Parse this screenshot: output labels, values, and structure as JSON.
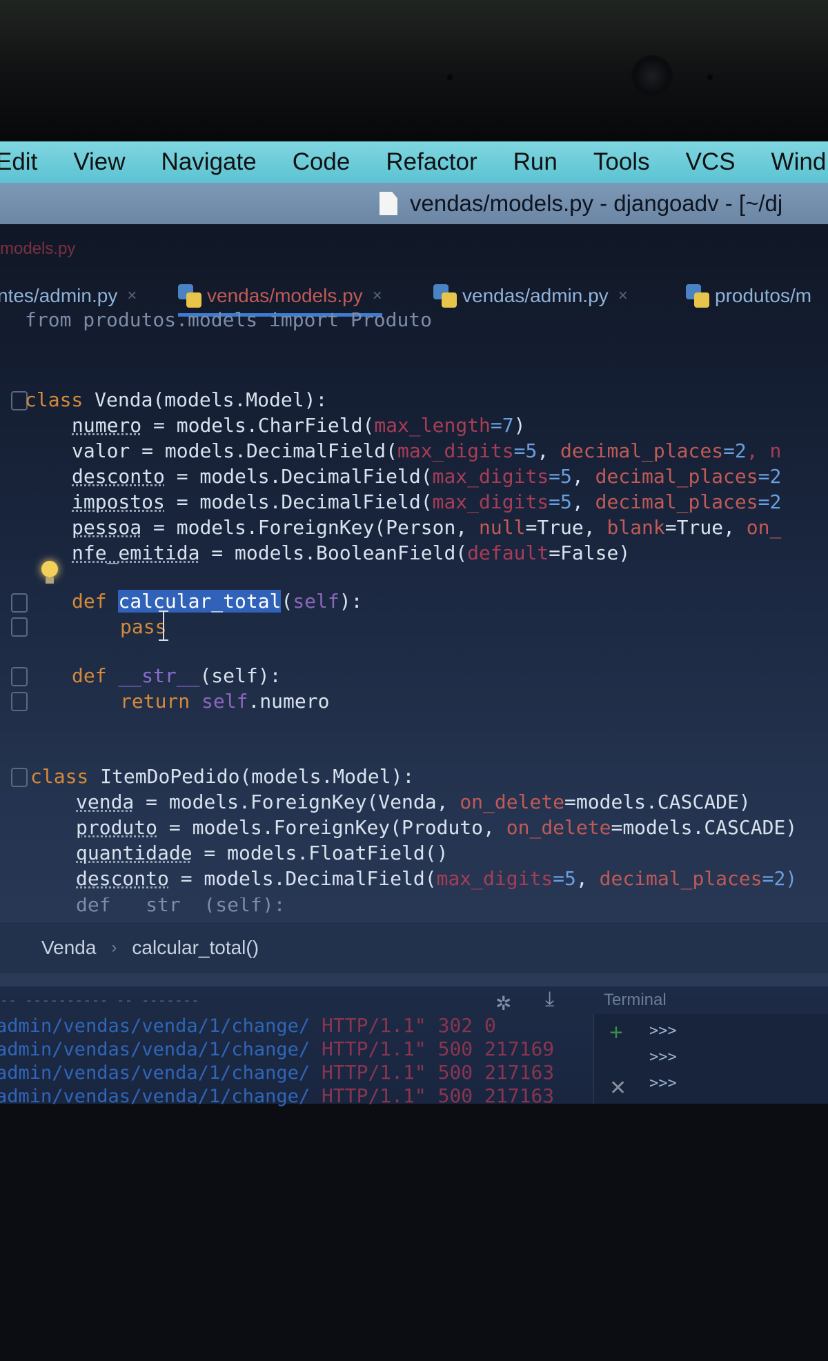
{
  "menu": [
    "Edit",
    "View",
    "Navigate",
    "Code",
    "Refactor",
    "Run",
    "Tools",
    "VCS",
    "Wind"
  ],
  "window_title": "vendas/models.py - djangoadv - [~/dj",
  "nav_crumb": "models.py",
  "tabs": [
    {
      "label": "ntes/admin.py",
      "active": false
    },
    {
      "label": "vendas/models.py",
      "active": true
    },
    {
      "label": "vendas/admin.py",
      "active": false
    },
    {
      "label": "produtos/m",
      "active": false
    }
  ],
  "code": {
    "l0": "from produtos.models import Produto",
    "l1": {
      "kw": "class",
      "name": "Venda(models.Model):"
    },
    "l2": {
      "a": "numero",
      "b": " = models.CharField(",
      "p1": "max_length",
      "v1": "=7",
      "e": ")"
    },
    "l3": {
      "a": "valor",
      "b": " = models.DecimalField(",
      "p1": "max_digits",
      "v1": "=5",
      "c1": ", ",
      "p2": "decimal_places",
      "v2": "=2",
      "c2": ", n"
    },
    "l4": {
      "a": "desconto",
      "b": " = models.DecimalField(",
      "p1": "max_digits",
      "v1": "=5",
      "c1": ", ",
      "p2": "decimal_places",
      "v2": "=2"
    },
    "l5": {
      "a": "impostos",
      "b": " = models.DecimalField(",
      "p1": "max_digits",
      "v1": "=5",
      "c1": ", ",
      "p2": "decimal_places",
      "v2": "=2"
    },
    "l6": {
      "a": "pessoa",
      "b": " = models.ForeignKey(Person, ",
      "p1": "null",
      "v1": "=True",
      "c1": ", ",
      "p2": "blank",
      "v2": "=True",
      "c2": ", ",
      "p3": "on_"
    },
    "l7": {
      "a": "nfe_emitida",
      "b": " = models.BooleanField(",
      "p1": "default",
      "v1": "=False",
      "e": ")"
    },
    "l8": {
      "kw": "def",
      "fn": "calcular_total",
      "op": "(",
      "self": "self",
      "cl": "):"
    },
    "l9": {
      "kw": "pass"
    },
    "l10": {
      "kw": "def",
      "dn": "__str__",
      "rest": "(self):"
    },
    "l11": {
      "kw": "return",
      "self": "self",
      "rest": ".numero"
    },
    "l12": {
      "kw": "class",
      "name": "ItemDoPedido(models.Model):"
    },
    "l13": {
      "a": "venda",
      "b": " = models.ForeignKey(Venda, ",
      "p1": "on_delete",
      "v1": "=models.CASCADE)"
    },
    "l14": {
      "a": "produto",
      "b": " = models.ForeignKey(Produto, ",
      "p1": "on_delete",
      "v1": "=models.CASCADE)"
    },
    "l15": {
      "a": "quantidade",
      "b": " = models.FloatField()"
    },
    "l16": {
      "a": "desconto",
      "b": " = models.DecimalField(",
      "p1": "max_digits",
      "v1": "=5",
      "c1": ", ",
      "p2": "decimal_places",
      "v2": "=2)"
    },
    "l17": "def __str__(self):"
  },
  "breadcrumb": {
    "class_name": "Venda",
    "method": "calcular_total()"
  },
  "bottom": {
    "top_clip": "-- ---------- -- -------",
    "terminal_label": "Terminal",
    "prompts": [
      ">>>",
      ">>>",
      ">>>"
    ],
    "logs": [
      {
        "path": "admin/vendas/venda/1/change/",
        "proto": " HTTP/1.1\"",
        "status": " 302 0"
      },
      {
        "path": "admin/vendas/venda/1/change/",
        "proto": " HTTP/1.1\"",
        "status": " 500 217169"
      },
      {
        "path": "admin/vendas/venda/1/change/",
        "proto": " HTTP/1.1\"",
        "status": " 500 217163"
      },
      {
        "path": "admin/vendas/venda/1/change/",
        "proto": " HTTP/1.1\"",
        "status": " 500 217163"
      }
    ]
  },
  "colors": {
    "menu_bg": "#5cc3d2",
    "title_bg": "#6c86a4",
    "editor_bg": "#19253d",
    "keyword": "#d48a3a",
    "param": "#a73d55",
    "number": "#6a9fe0",
    "selection": "#2f62b8"
  }
}
